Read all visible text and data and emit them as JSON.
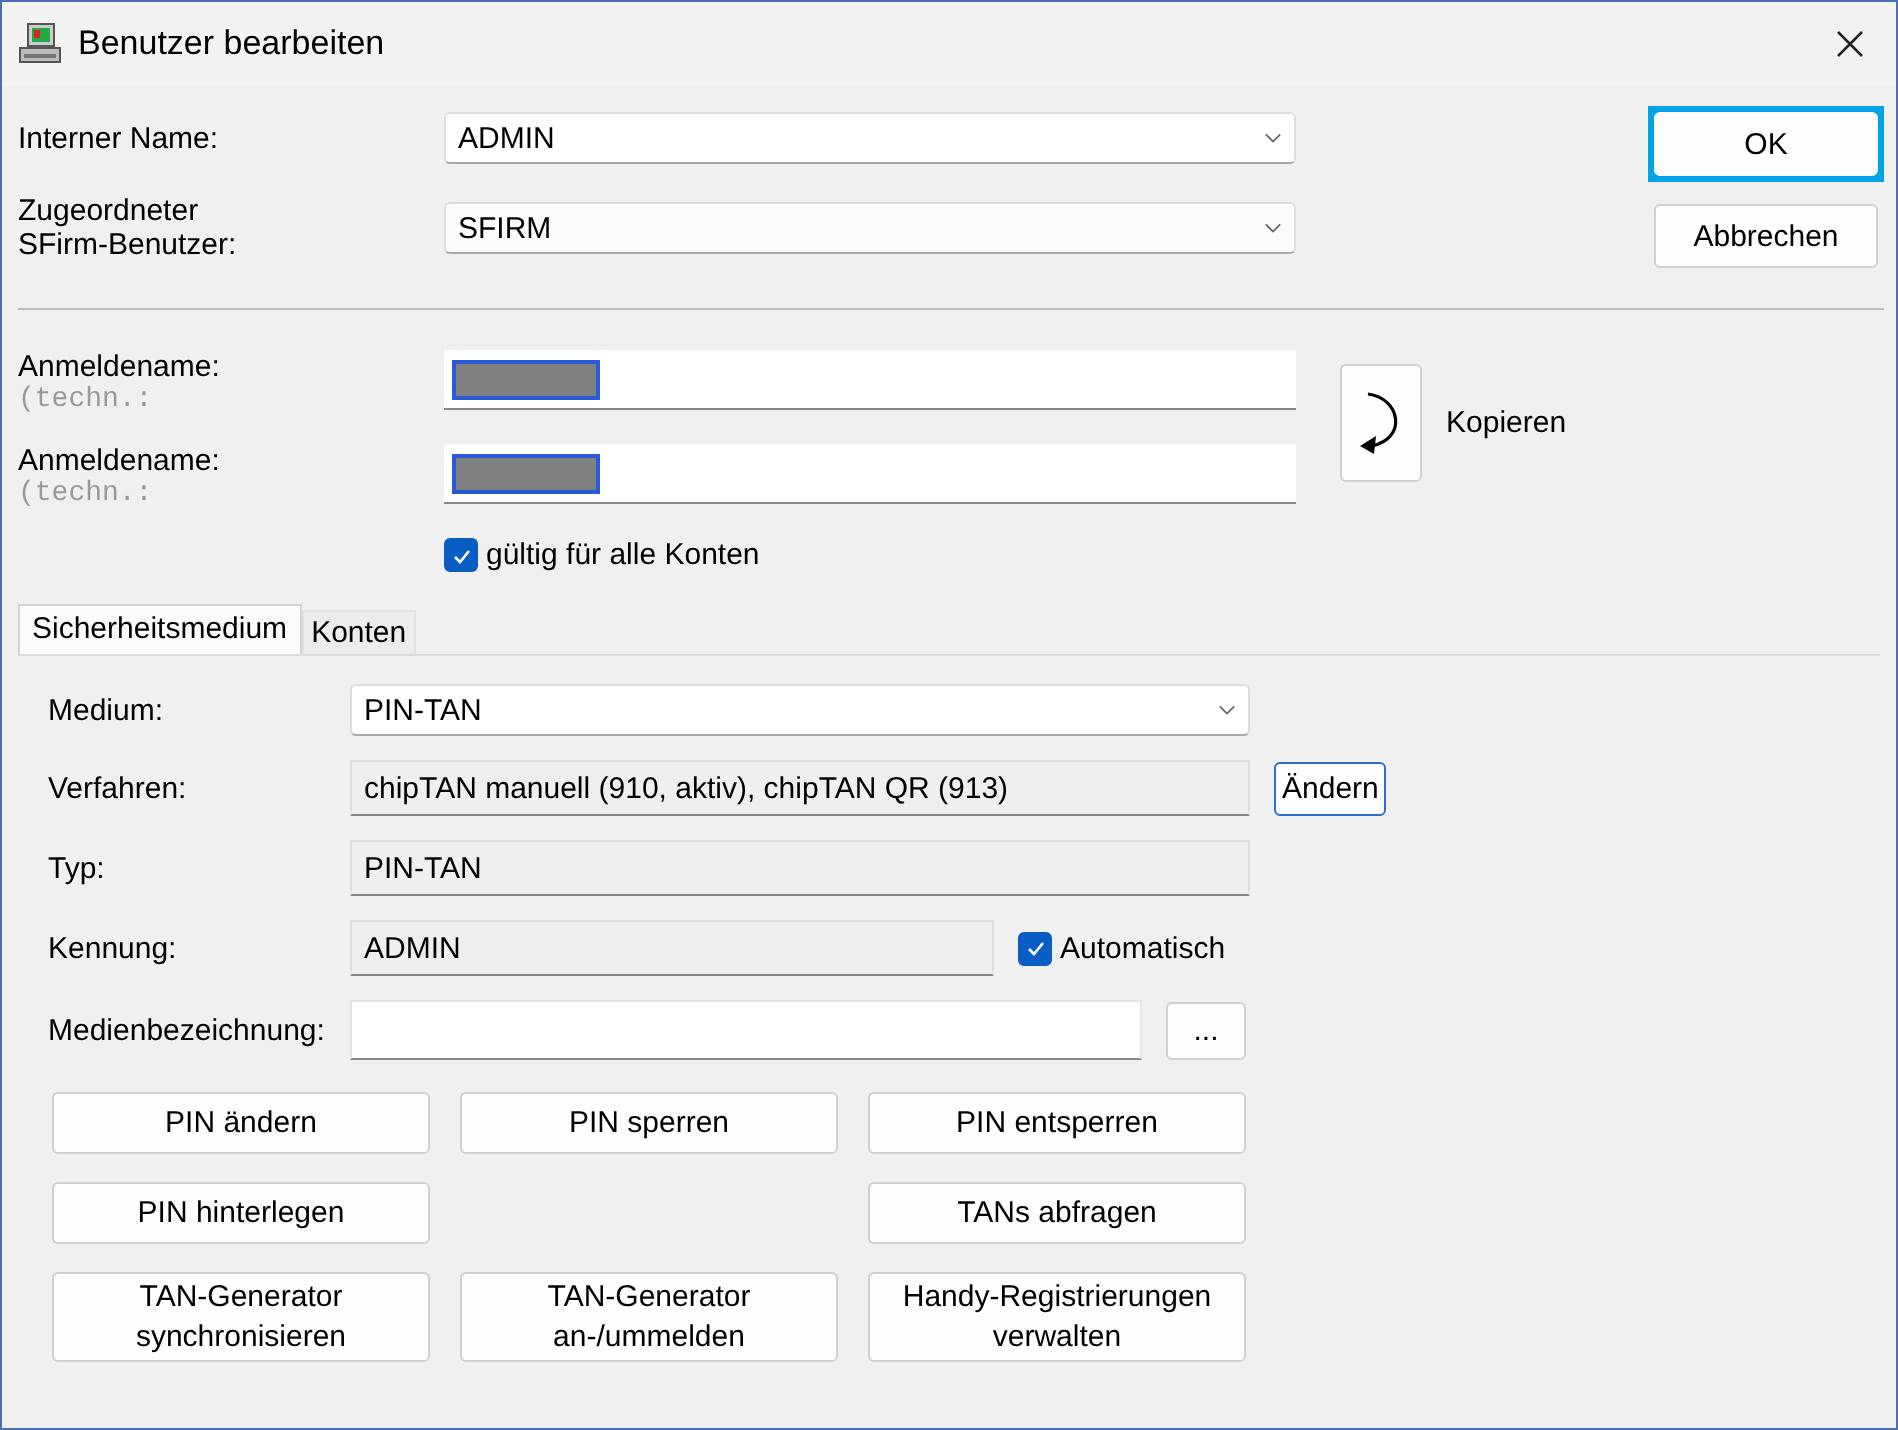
{
  "window": {
    "title": "Benutzer bearbeiten"
  },
  "user_fields": [
    {
      "label": "Interner Name:",
      "value": "ADMIN",
      "kind": "select"
    },
    {
      "label": "Zugeordneter\nSFirm-Benutzer:",
      "value": "SFIRM",
      "kind": "select"
    }
  ],
  "dialog_buttons": [
    {
      "label": "OK",
      "focused": true
    },
    {
      "label": "Abbrechen",
      "focused": false
    }
  ],
  "login_fields": [
    {
      "label": "Anmeldename:",
      "sublabel": "(techn.:",
      "redacted": true
    },
    {
      "label": "Anmeldename:",
      "sublabel": "(techn.:",
      "redacted": true
    }
  ],
  "copy_button": {
    "label": "Kopieren"
  },
  "all_accounts": {
    "label": "gültig für alle Konten",
    "checked": true
  },
  "tabs": [
    {
      "label": "Sicherheitsmedium",
      "selected": true
    },
    {
      "label": "Konten",
      "selected": false
    }
  ],
  "medium_rows": [
    {
      "kind": "select",
      "label": "Medium:",
      "value": "PIN-TAN"
    },
    {
      "kind": "readonly_button",
      "label": "Verfahren:",
      "value": "chipTAN manuell (910, aktiv), chipTAN QR (913)",
      "button": "Ändern"
    },
    {
      "kind": "readonly",
      "label": "Typ:",
      "value": "PIN-TAN"
    },
    {
      "kind": "readonly_check",
      "label": "Kennung:",
      "value": "ADMIN",
      "check": {
        "label": "Automatisch",
        "checked": true
      }
    },
    {
      "kind": "input_button",
      "label": "Medienbezeichnung:",
      "value": "",
      "button": "..."
    }
  ],
  "actions": [
    [
      {
        "label": "PIN ändern"
      },
      {
        "label": "PIN sperren"
      },
      {
        "label": "PIN entsperren"
      }
    ],
    [
      {
        "label": "PIN hinterlegen"
      },
      {
        "label": "TANs abfragen"
      }
    ],
    [
      {
        "label": "TAN-Generator\nsynchronisieren"
      },
      {
        "label": "TAN-Generator\nan-/ummelden"
      },
      {
        "label": "Handy-Registrierungen\nverwalten"
      }
    ]
  ]
}
